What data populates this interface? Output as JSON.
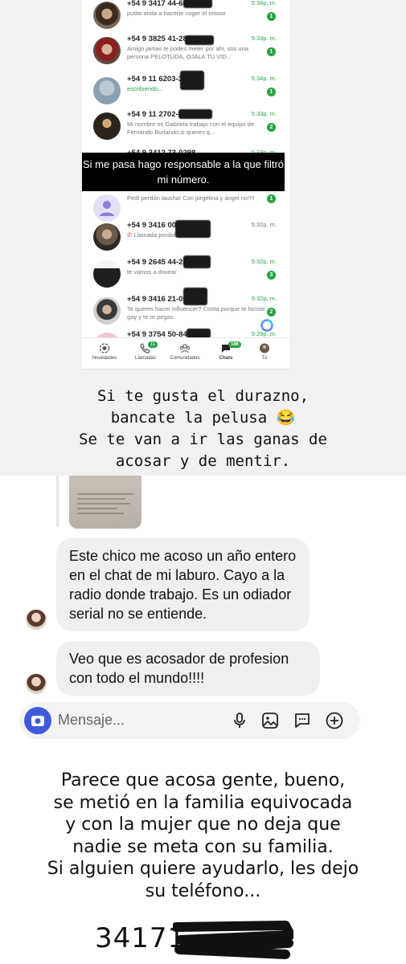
{
  "whatsapp": {
    "chats": [
      {
        "name": "+54 9 3417 44-6090",
        "preview": "putito anda a hacerte coger el ortooo",
        "time": "5:34p. m.",
        "badge": "1"
      },
      {
        "name": "+54 9 3825 41-2878",
        "preview": "Amigo jamas te podes meter por ahi, sos una persona PELOTUDA, OJALA TU VID...",
        "time": "5:33p. m.",
        "badge": "1"
      },
      {
        "name": "+54 9 11 6203-3007",
        "preview": "escribiendo...",
        "time": "5:34p. m.",
        "badge": "1"
      },
      {
        "name": "+54 9 11 2702-0538",
        "preview": "Mi nombre es Gabriela trabajo con el equipo de Fernando Burlando,si queres q...",
        "time": "5:33p. m.",
        "badge": "2"
      },
      {
        "name": "+54 9 3412 73-0298",
        "preview": "",
        "time": "5:33p. m.",
        "badge": ""
      },
      {
        "name": "",
        "preview": "Pedí perdón laucha! Con jorgelina y ángel no!!!!",
        "time": "",
        "badge": "1"
      },
      {
        "name": "+54 9 3416 00-6939",
        "preview": "Llamada perdida",
        "time": "5:32p. m.",
        "badge": ""
      },
      {
        "name": "+54 9 2645 44-2840",
        "preview": "te vamos a doxear",
        "time": "5:32p. m.",
        "badge": "3"
      },
      {
        "name": "+54 9 3416 21-0036",
        "preview": "Te queres hacer influencer? Conta porque te hiciste gay y te re pegas",
        "time": "5:32p. m.",
        "badge": "2"
      },
      {
        "name": "+54 9 3754 50-8468",
        "preview": "",
        "time": "5:29p. m.",
        "badge": ""
      }
    ],
    "overlay_caption": "Si me pasa hago responsable a la que filtró mi número.",
    "tabs": [
      {
        "label": "Novedades",
        "icon": "status-icon",
        "count": ""
      },
      {
        "label": "Llamadas",
        "icon": "phone-icon",
        "count": "11"
      },
      {
        "label": "Comunidades",
        "icon": "communities-icon",
        "count": ""
      },
      {
        "label": "Chats",
        "icon": "chat-icon",
        "count": "186"
      },
      {
        "label": "Tú",
        "icon": "profile-icon",
        "count": ""
      }
    ],
    "accent": "#25a244"
  },
  "story_text": [
    "Si te gusta el durazno,",
    "bancate la pelusa 😂",
    "Se te van a ir las ganas de",
    "acosar y de mentir."
  ],
  "dm": {
    "messages": [
      "Este chico me acoso un año entero en el chat de mi laburo. Cayo a la radio donde trabajo. Es un odiador serial no se entiende.",
      "Veo que es acosador de profesion con todo el mundo!!!!"
    ],
    "composer_placeholder": "Mensaje...",
    "composer_icons": [
      "microphone-icon",
      "gallery-icon",
      "sticker-icon",
      "add-icon"
    ],
    "camera_color": "#3f5bdb"
  },
  "bottom_text": [
    "Parece que acosa gente, bueno,",
    "se metió en la familia equivocada",
    "y con la mujer que no deja que",
    "nadie se meta con su familia.",
    "Si alguien quiere ayudarlo, les dejo",
    "su teléfono..."
  ],
  "phone_number_visible": "34171"
}
